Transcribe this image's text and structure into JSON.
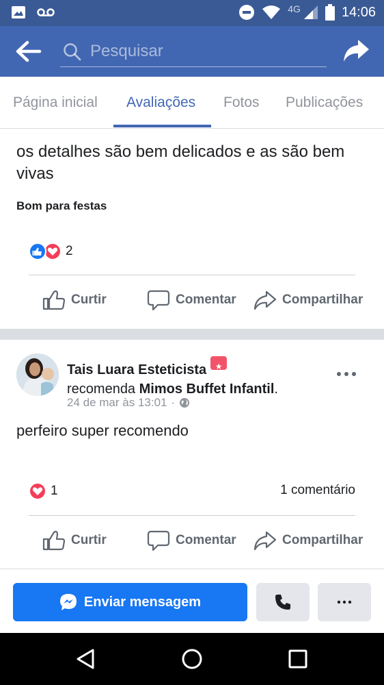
{
  "status_bar": {
    "network": "4G",
    "time": "14:06"
  },
  "app_bar": {
    "search_placeholder": "Pesquisar"
  },
  "tabs": [
    {
      "label": "Página inicial"
    },
    {
      "label": "Avaliações"
    },
    {
      "label": "Fotos"
    },
    {
      "label": "Publicações"
    }
  ],
  "active_tab": "Avaliações",
  "post1": {
    "text": "os detalhes são bem delicados e as são bem vivas",
    "tag": "Bom para festas",
    "reaction_count": "2",
    "actions": {
      "like": "Curtir",
      "comment": "Comentar",
      "share": "Compartilhar"
    }
  },
  "post2": {
    "author": "Tais Luara Esteticista",
    "verb": "recomenda",
    "page": "Mimos Buffet Infantil",
    "timestamp": "24 de mar às 13:01",
    "text": "perfeiro super recomendo",
    "reaction_count": "1",
    "comments": "1 comentário",
    "actions": {
      "like": "Curtir",
      "comment": "Comentar",
      "share": "Compartilhar"
    }
  },
  "bottom_bar": {
    "message_button": "Enviar mensagem"
  },
  "colors": {
    "status_bar": "#3a5a96",
    "app_bar": "#4267b2",
    "primary_button": "#1877f2",
    "love": "#f33e58"
  },
  "icons": [
    "image-icon",
    "voicemail-icon",
    "dnd-icon",
    "wifi-icon",
    "signal-icon",
    "battery-icon",
    "back-arrow-icon",
    "search-icon",
    "share-arrow-icon",
    "like-icon",
    "love-icon",
    "thumbs-up-icon",
    "comment-icon",
    "share-icon",
    "globe-icon",
    "more-icon",
    "messenger-icon",
    "phone-icon",
    "nav-back-icon",
    "nav-home-icon",
    "nav-recent-icon"
  ]
}
